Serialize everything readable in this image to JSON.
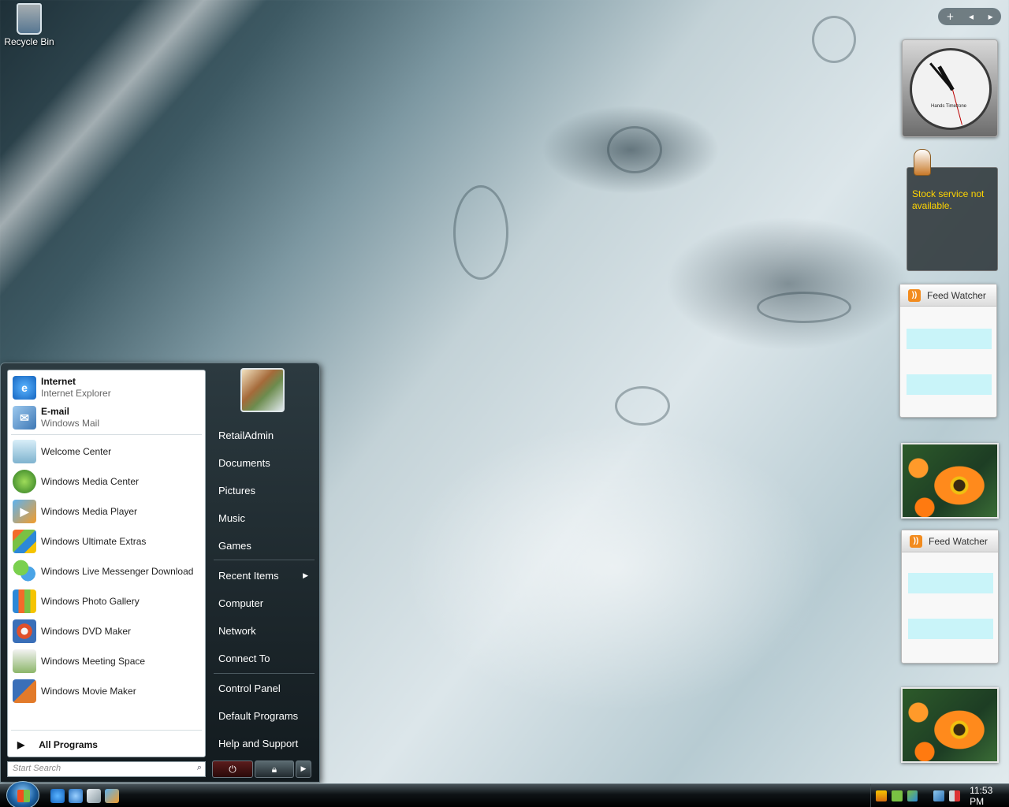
{
  "desktop": {
    "icons": [
      {
        "label": "Recycle Bin",
        "icon": "recycle-bin-icon"
      }
    ]
  },
  "start_menu": {
    "pinned": [
      {
        "title": "Internet",
        "subtitle": "Internet Explorer",
        "icon": "internet-explorer-icon"
      },
      {
        "title": "E-mail",
        "subtitle": "Windows Mail",
        "icon": "windows-mail-icon"
      }
    ],
    "recent": [
      {
        "label": "Welcome Center",
        "icon": "welcome-center-icon"
      },
      {
        "label": "Windows Media Center",
        "icon": "media-center-icon"
      },
      {
        "label": "Windows Media Player",
        "icon": "media-player-icon"
      },
      {
        "label": "Windows Ultimate Extras",
        "icon": "ultimate-extras-icon"
      },
      {
        "label": "Windows Live Messenger Download",
        "icon": "messenger-icon"
      },
      {
        "label": "Windows Photo Gallery",
        "icon": "photo-gallery-icon"
      },
      {
        "label": "Windows DVD Maker",
        "icon": "dvd-maker-icon"
      },
      {
        "label": "Windows Meeting Space",
        "icon": "meeting-space-icon"
      },
      {
        "label": "Windows Movie Maker",
        "icon": "movie-maker-icon"
      }
    ],
    "all_programs_label": "All Programs",
    "search_placeholder": "Start Search",
    "right": [
      {
        "label": "RetailAdmin"
      },
      {
        "label": "Documents"
      },
      {
        "label": "Pictures"
      },
      {
        "label": "Music"
      },
      {
        "label": "Games"
      },
      {
        "label": "Recent Items",
        "has_submenu": true
      },
      {
        "label": "Computer"
      },
      {
        "label": "Network"
      },
      {
        "label": "Connect To"
      },
      {
        "label": "Control Panel"
      },
      {
        "label": "Default Programs"
      },
      {
        "label": "Help and Support"
      }
    ]
  },
  "taskbar": {
    "quick_launch": [
      "internet-explorer-icon",
      "ie-icon",
      "switch-windows-icon",
      "media-player-icon"
    ],
    "tray_icons": [
      "shield-icon",
      "network-icon",
      "volume-icon"
    ],
    "clock": "11:53 PM"
  },
  "sidebar": {
    "controls": {
      "add": "+",
      "prev": "◂",
      "next": "▸"
    },
    "clock_gadget_label": "Hands Timezone",
    "stock_message": "Stock service not available.",
    "feed_gadgets": [
      {
        "title": "Feed Watcher"
      },
      {
        "title": "Feed Watcher"
      }
    ]
  },
  "colors": {
    "start_menu_bg": "#1c262b",
    "feed_row": "#c9f4f9",
    "stock_text": "#ffd400"
  }
}
